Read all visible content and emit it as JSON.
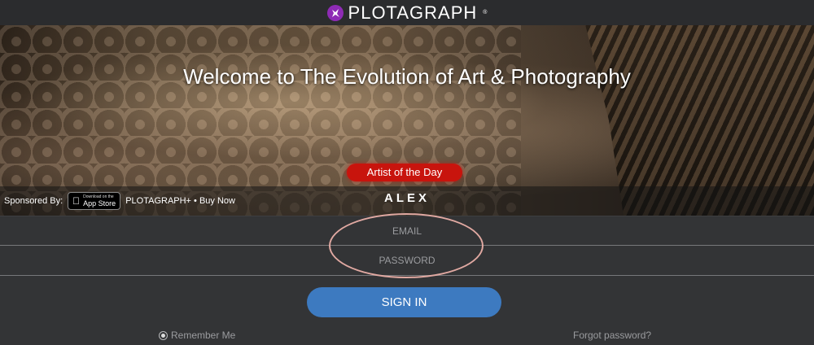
{
  "header": {
    "logo_text": "PLOTAGRAPH",
    "logo_reg": "®",
    "logo_icon": "plotagraph-logo-icon",
    "accent": "#8e2bb5"
  },
  "hero": {
    "title": "Welcome to The Evolution of Art & Photography",
    "artist_badge": "Artist of the Day",
    "artist_name": "ALEX",
    "badge_color": "#c8140d"
  },
  "sponsor": {
    "label": "Sponsored By:",
    "appstore_small": "Download on the",
    "appstore_big": "App Store",
    "promo_text": "PLOTAGRAPH+ • Buy Now"
  },
  "form": {
    "email_placeholder": "EMAIL",
    "password_placeholder": "PASSWORD",
    "signin_label": "SIGN IN",
    "remember_label": "Remember Me",
    "forgot_label": "Forgot password?",
    "button_color": "#3d7ac0"
  }
}
